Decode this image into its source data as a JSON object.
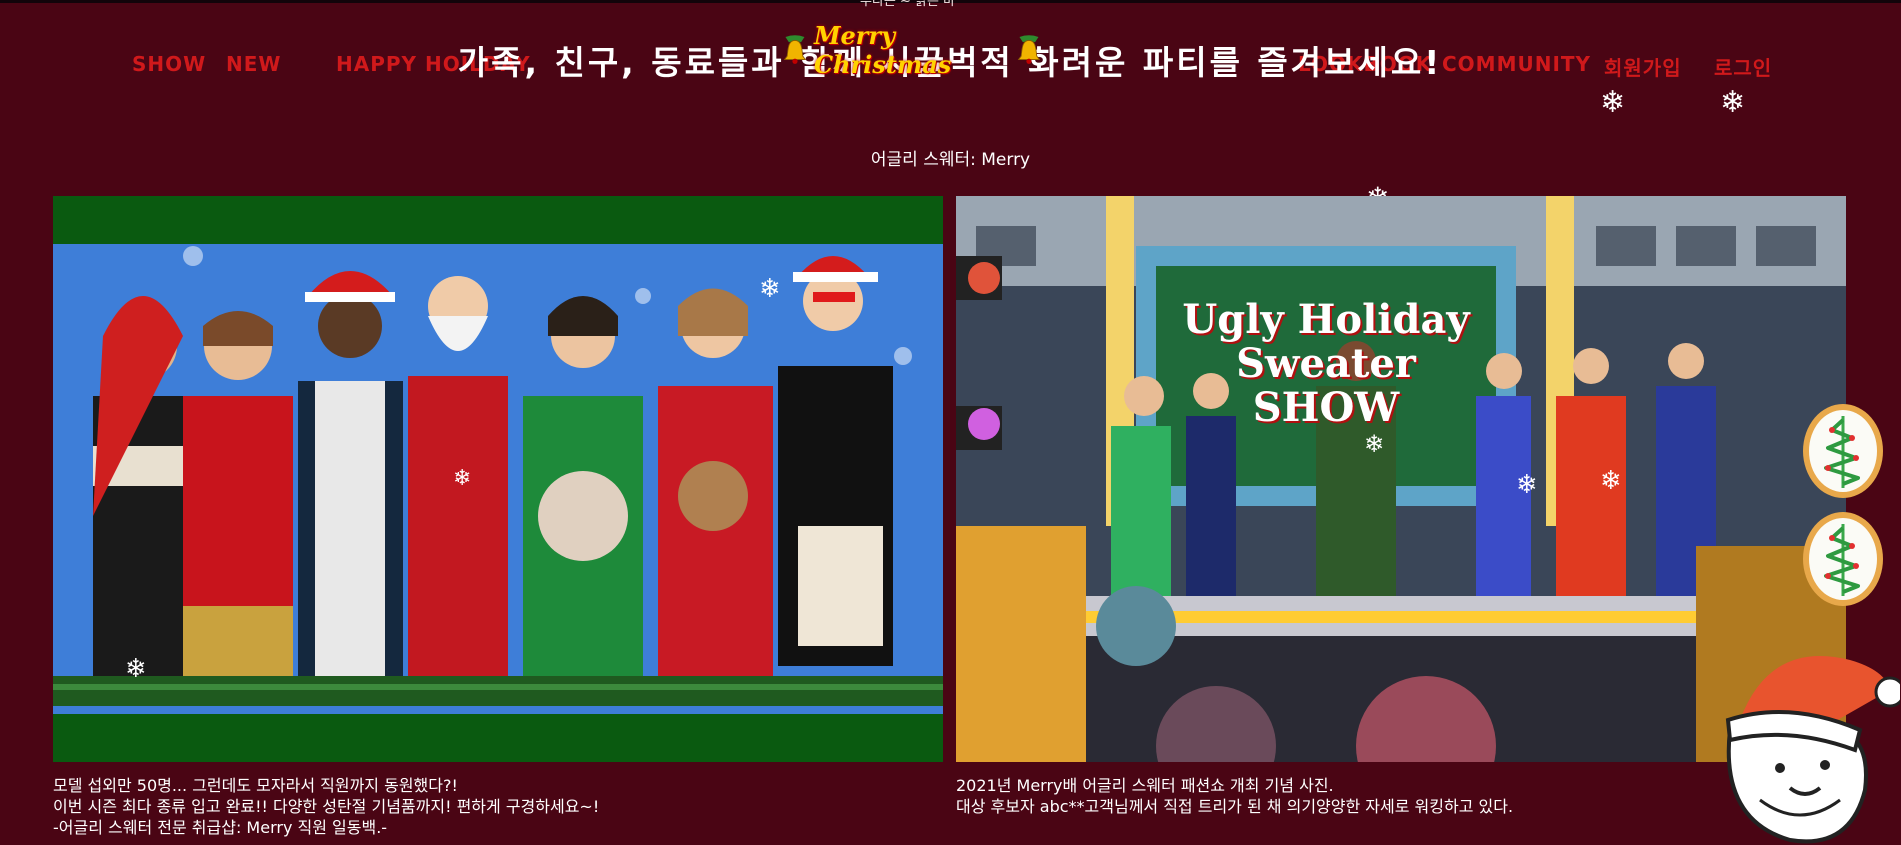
{
  "top_text": "수다는 ~ 밝은 마",
  "nav": {
    "show": "SHOW",
    "new": "NEW",
    "happy_holiday": "HAPPY HOILDAY",
    "lookbook": "LOOKBOOK",
    "community": "COMMUNITY",
    "signup": "회원가입",
    "login": "로그인"
  },
  "banner": {
    "text": "가족, 친구, 동료들과 함께 시끌벅적 화려운 파티를 즐겨보세요!",
    "badge_text": "Merry Christmas"
  },
  "caption_top": "어글리 스웨터: Merry",
  "photo1": {
    "description_lines": [
      "모델 섭외만 50명... 그런데도 모자라서 직원까지 동원했다?!",
      "이번 시즌 최다 종류 입고 완료!! 다양한 성탄절 기념품까지! 편하게 구경하세요~!",
      "-어글리 스웨터 전문 취급샵: Merry 직원 일동백.-"
    ]
  },
  "photo2": {
    "sign_lines": [
      "Ugly Holiday",
      "Sweater",
      "SHOW"
    ],
    "description_lines": [
      "2021년 Merry배 어글리 스웨터 패션쇼 개최 기념 사진.",
      "대상 후보자 abc**고객님께서 직접 트리가 된 채 의기양양한 자세로 워킹하고 있다."
    ]
  },
  "colors": {
    "background": "#4a0514",
    "nav_text": "#d0191b",
    "banner_text": "#ffffff",
    "photo_frame_green": "#0a5a10"
  },
  "icons": [
    "bell-icon",
    "snowflake-icon",
    "tree-cookie-icon",
    "santa-icon"
  ]
}
